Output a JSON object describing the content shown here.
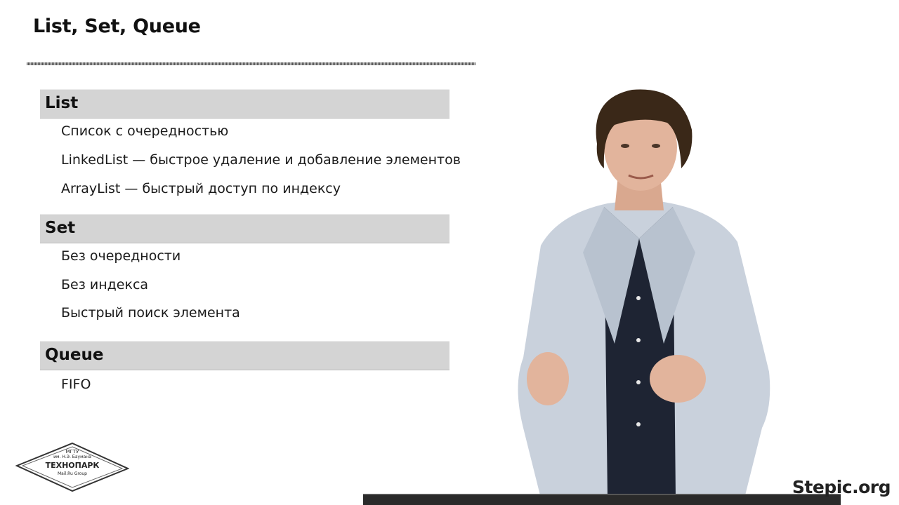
{
  "slide": {
    "title": "List, Set, Queue"
  },
  "sections": [
    {
      "header": "List",
      "items": [
        "Список с очередностью",
        "LinkedList — быстрое удаление и добавление элементов",
        "ArrayList — быстрый доступ по индексу"
      ]
    },
    {
      "header": "Set",
      "items": [
        "Без очередности",
        "Без индекса",
        "Быстрый поиск элемента"
      ]
    },
    {
      "header": "Queue",
      "items": [
        "FIFO"
      ]
    }
  ],
  "logo": {
    "line1": "МГТУ",
    "line2": "им. Н.Э. Баумана",
    "line3": "ТЕХНОПАРК",
    "line4": "Mail.Ru Group"
  },
  "watermark": "Stepic.org",
  "colors": {
    "section_header_bg": "#d4d4d4",
    "jacket": "#c9d1dc",
    "shirt": "#1e2433",
    "hair": "#3a2818",
    "skin": "#e2b49c"
  }
}
